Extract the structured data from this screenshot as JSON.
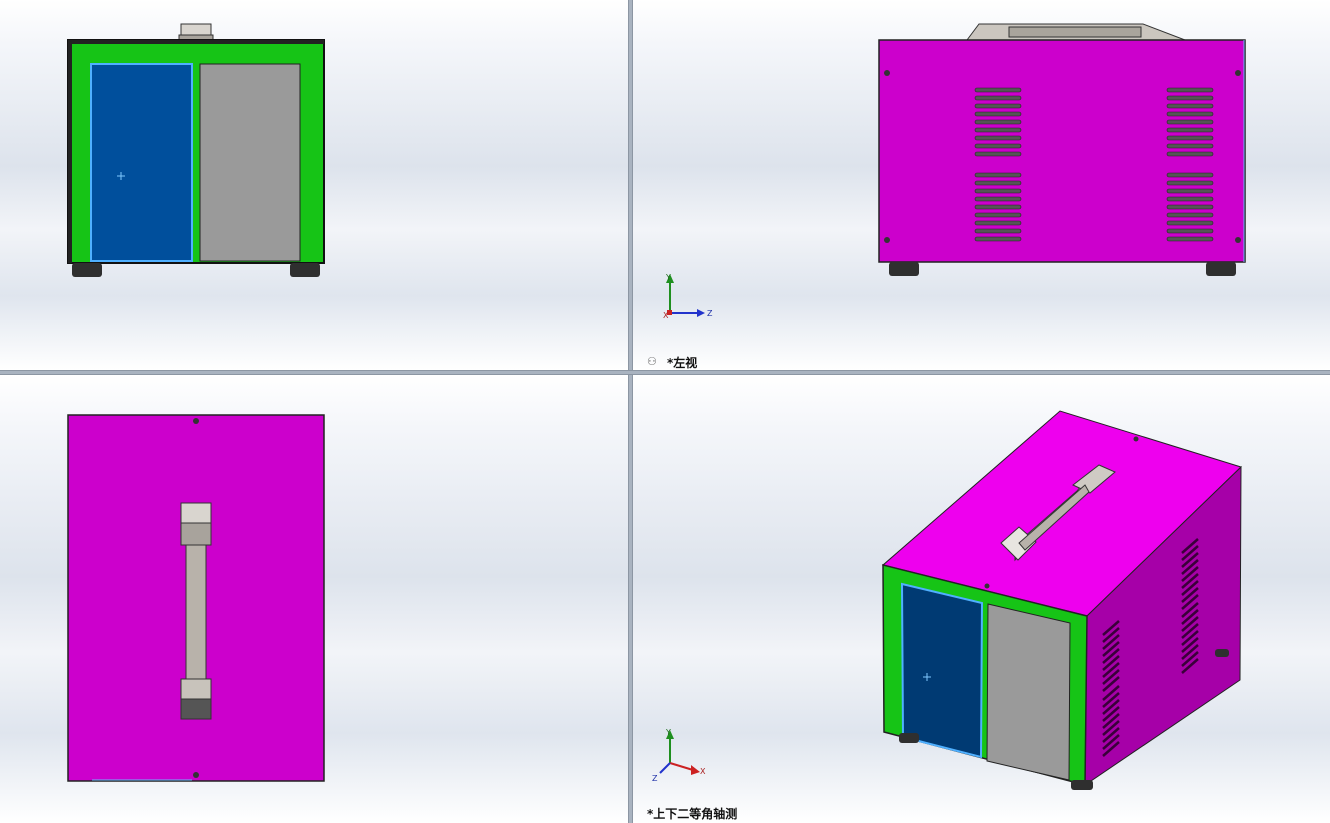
{
  "viewports": {
    "top_left": {
      "name": "front-view-viewport"
    },
    "top_right": {
      "name": "left-view-viewport",
      "label": "*左视"
    },
    "bottom_left": {
      "name": "top-view-viewport"
    },
    "bottom_right": {
      "name": "isometric-view-viewport",
      "label": "*上下二等角轴测"
    }
  },
  "triad": {
    "x": "X",
    "y": "Y",
    "z": "Z"
  },
  "colors": {
    "body_magenta": "#cc00cc",
    "front_green": "#16c416",
    "door_blue": "#004f9c",
    "panel_gray": "#9a9a9a",
    "handle_gray": "#b8b2aa",
    "foot_dark": "#2f2f2f"
  },
  "icons": {
    "view_icon": "glasses-icon"
  }
}
